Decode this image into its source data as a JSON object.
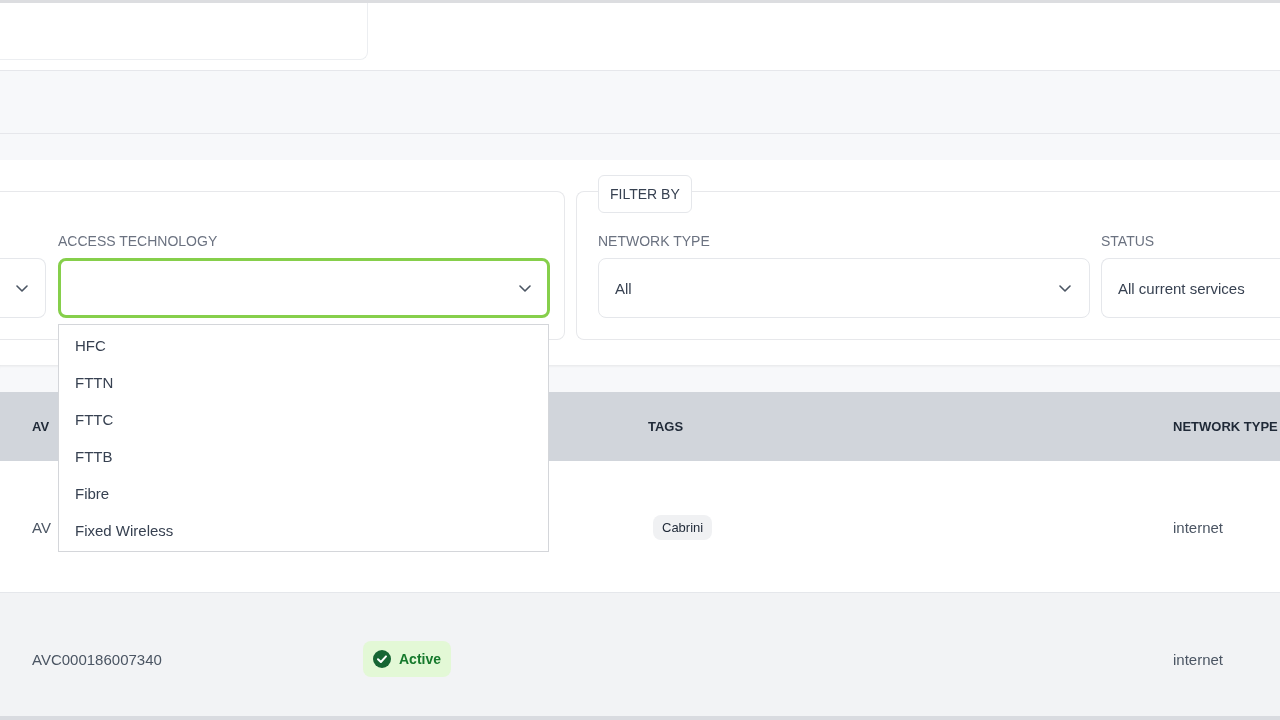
{
  "filters": {
    "groups": [
      {
        "fields": [
          {
            "kind": "select",
            "focused": false
          },
          {
            "kind": "select",
            "label": "ACCESS TECHNOLOGY",
            "focused": true,
            "options": [
              "HFC",
              "FTTN",
              "FTTC",
              "FTTB",
              "Fibre",
              "Fixed Wireless"
            ]
          }
        ]
      },
      {
        "legend": "FILTER BY",
        "fields": [
          {
            "kind": "select",
            "label": "NETWORK TYPE",
            "value": "All",
            "focused": false
          },
          {
            "kind": "select",
            "label": "STATUS",
            "value": "All current services",
            "focused": false
          }
        ]
      }
    ]
  },
  "table": {
    "header": {
      "column_1": "AV",
      "tags": "TAGS",
      "network_type": "NETWORK TYPE"
    },
    "rows": [
      {
        "column_1": "AV",
        "tags": [
          "Cabrini"
        ],
        "network_type": "internet"
      },
      {
        "column_1": "AVC000186007340",
        "column_2": {
          "kind": "success",
          "label": "Active"
        },
        "network_type": "internet"
      }
    ]
  }
}
